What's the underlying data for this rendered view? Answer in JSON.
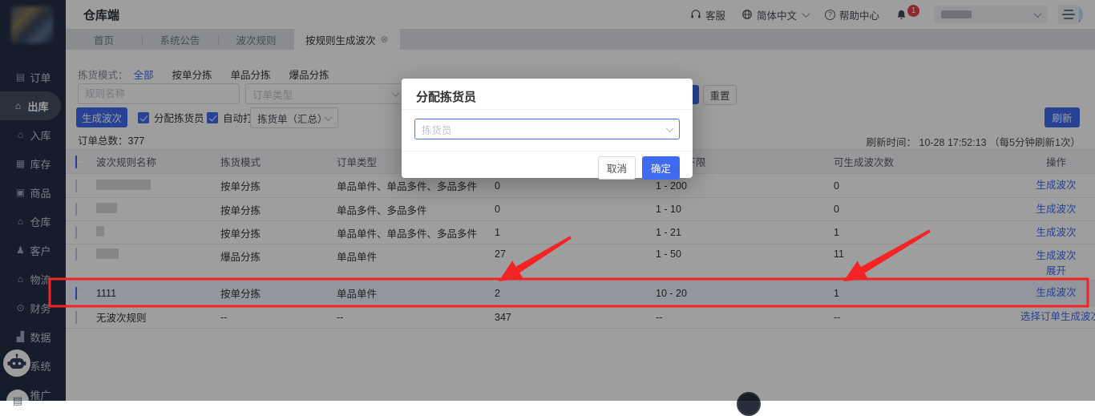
{
  "colors": {
    "primary": "#3f6bf0",
    "annotation": "#f52323",
    "badge": "#e7434f",
    "sidebar_bg": "#232e44"
  },
  "app": {
    "title": "仓库端"
  },
  "topbar": {
    "service_label": "客服",
    "language_label": "简体中文",
    "help_label": "帮助中心",
    "notification_count": "1"
  },
  "tabs": [
    {
      "key": "home",
      "label": "首页",
      "active": false
    },
    {
      "key": "system-notice",
      "label": "系统公告",
      "active": false
    },
    {
      "key": "wave-rules",
      "label": "波次规则",
      "active": false
    },
    {
      "key": "generate-waves-by-rule",
      "label": "按规则生成波次",
      "active": true,
      "close_icon": "⊗"
    }
  ],
  "sidebar": {
    "items": [
      {
        "key": "orders",
        "label": "订单",
        "icon": "order-doc-icon",
        "active": false
      },
      {
        "key": "outbound",
        "label": "出库",
        "icon": "outbound-house-icon",
        "active": true
      },
      {
        "key": "inbound",
        "label": "入库",
        "icon": "inbound-house-icon",
        "active": false
      },
      {
        "key": "inventory",
        "label": "库存",
        "icon": "inventory-icon",
        "active": false
      },
      {
        "key": "products",
        "label": "商品",
        "icon": "product-bag-icon",
        "active": false
      },
      {
        "key": "warehouse",
        "label": "仓库",
        "icon": "warehouse-house-icon",
        "active": false
      },
      {
        "key": "customers",
        "label": "客户",
        "icon": "customer-person-icon",
        "active": false
      },
      {
        "key": "logistics",
        "label": "物流",
        "icon": "logistics-house-icon",
        "active": false
      },
      {
        "key": "finance",
        "label": "财务",
        "icon": "finance-coin-icon",
        "active": false
      },
      {
        "key": "data",
        "label": "数据",
        "icon": "data-chart-icon",
        "active": false
      },
      {
        "key": "system",
        "label": "系统",
        "icon": "system-gear-icon",
        "active": false
      },
      {
        "key": "promotion",
        "label": "推广",
        "icon": "promo-flag-icon",
        "active": false
      }
    ]
  },
  "filters": {
    "mode_label": "拣货模式：",
    "modes": [
      "全部",
      "按单分拣",
      "单品分拣",
      "爆品分拣"
    ],
    "active_mode": "全部",
    "rule_name_placeholder": "规则名称",
    "order_type_placeholder": "订单类型",
    "search_label": "",
    "reset_label": "重置"
  },
  "actions": {
    "generate_label": "生成波次",
    "assign_picker_label": "分配拣货员",
    "auto_print_label": "自动打印",
    "print_select_value": "拣货单（汇总）",
    "refresh_label": "刷新",
    "refresh_time_label": "刷新时间：",
    "refresh_time_value": "10-28 17:52:13",
    "refresh_time_note": "（每5分钟刷新1次）",
    "order_total_label": "订单总数：",
    "order_total_value": "377"
  },
  "table": {
    "headers": [
      "波次规则名称",
      "拣货模式",
      "订单类型",
      "",
      "单量上下限",
      "可生成波次数",
      "操作"
    ],
    "rows": [
      {
        "name": "",
        "name_redacted_width": 68,
        "checked": false,
        "mode": "按单分拣",
        "order_types": "单品单件、单品多件、多品多件",
        "count": "0",
        "limits": "1 - 200",
        "waves": "0",
        "actions": [
          "生成波次"
        ]
      },
      {
        "name": "",
        "name_redacted_width": 26,
        "checked": false,
        "mode": "按单分拣",
        "order_types": "单品多件、多品多件",
        "count": "0",
        "limits": "1 - 10",
        "waves": "0",
        "actions": [
          "生成波次"
        ]
      },
      {
        "name": "",
        "name_redacted_width": 10,
        "checked": false,
        "mode": "按单分拣",
        "order_types": "单品单件、单品多件、多品多件",
        "count": "1",
        "limits": "1 - 21",
        "waves": "1",
        "actions": [
          "生成波次"
        ]
      },
      {
        "name": "",
        "name_redacted_width": 28,
        "checked": false,
        "mode": "爆品分拣",
        "order_types": "单品单件",
        "count": "27",
        "limits": "1 - 50",
        "waves": "11",
        "actions": [
          "生成波次",
          "展开"
        ]
      },
      {
        "name": "1111",
        "checked": true,
        "selected": true,
        "mode": "按单分拣",
        "order_types": "单品单件",
        "count": "2",
        "limits": "10 - 20",
        "waves": "1",
        "actions": [
          "生成波次"
        ]
      },
      {
        "name": "无波次规则",
        "checked": false,
        "mode": "--",
        "order_types": "--",
        "count": "347",
        "limits": "--",
        "waves": "--",
        "actions": [
          "选择订单生成波次"
        ]
      }
    ]
  },
  "modal": {
    "title": "分配拣货员",
    "picker_placeholder": "拣货员",
    "cancel_label": "取消",
    "confirm_label": "确定"
  }
}
